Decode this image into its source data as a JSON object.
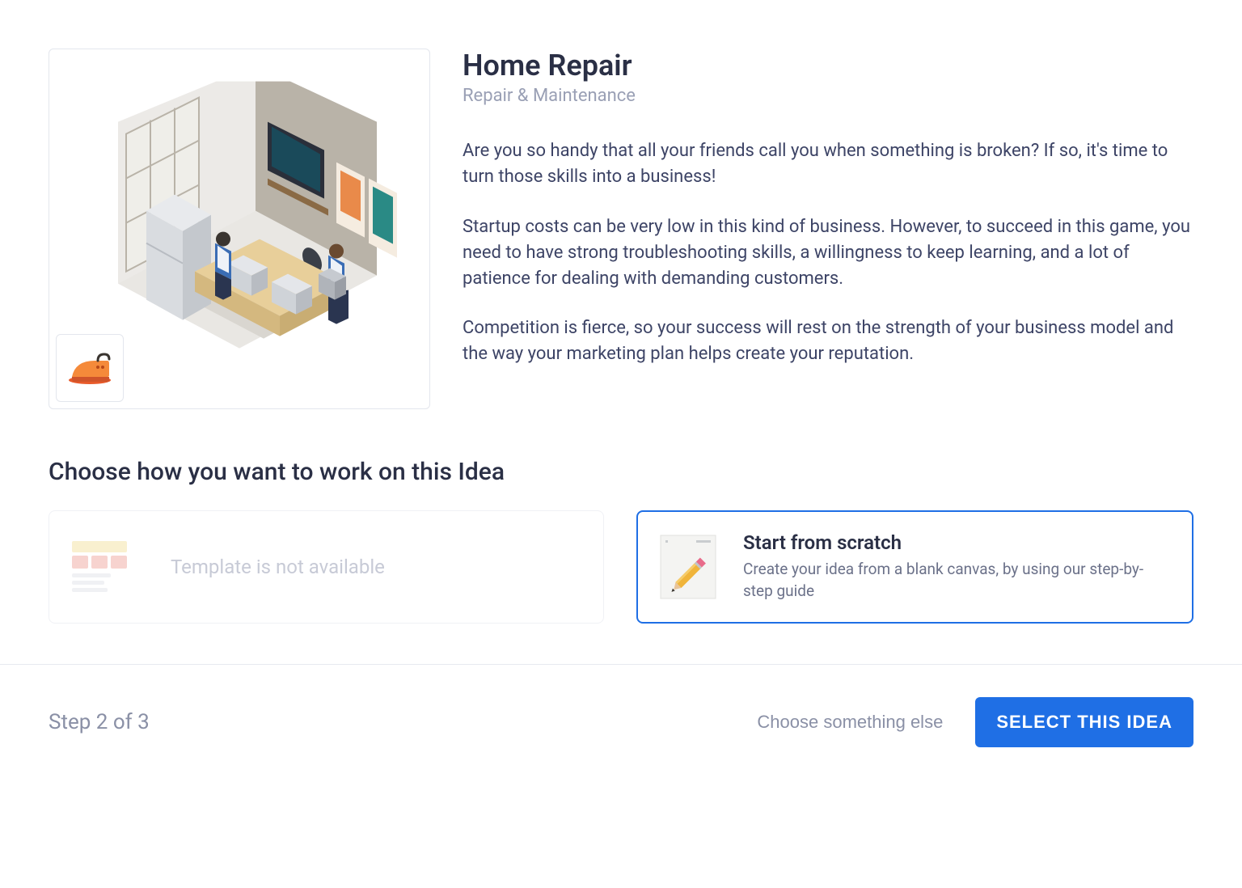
{
  "idea": {
    "title": "Home Repair",
    "category": "Repair & Maintenance",
    "paragraph1": "Are you so handy that all your friends call you when something is broken? If so, it's time to turn those skills into a business!",
    "paragraph2": "Startup costs can be very low in this kind of business. However, to succeed in this game, you need to have strong troubleshooting skills, a willingness to keep learning, and a lot of patience for dealing with demanding customers.",
    "paragraph3": "Competition is fierce, so your success will rest on the strength of your business model and the way your marketing plan helps create your reputation.",
    "badge_icon": "iron-icon"
  },
  "choose": {
    "heading": "Choose how you want to work on this Idea",
    "option_unavailable": "Template is not available",
    "option_scratch_title": "Start from scratch",
    "option_scratch_sub": "Create your idea from a blank canvas, by using our step-by-step guide"
  },
  "footer": {
    "step": "Step 2 of 3",
    "choose_else": "Choose something else",
    "select_button": "SELECT THIS IDEA"
  },
  "colors": {
    "primary": "#1f6fe5",
    "muted": "#9aa0b5",
    "text": "#2a2f45"
  }
}
